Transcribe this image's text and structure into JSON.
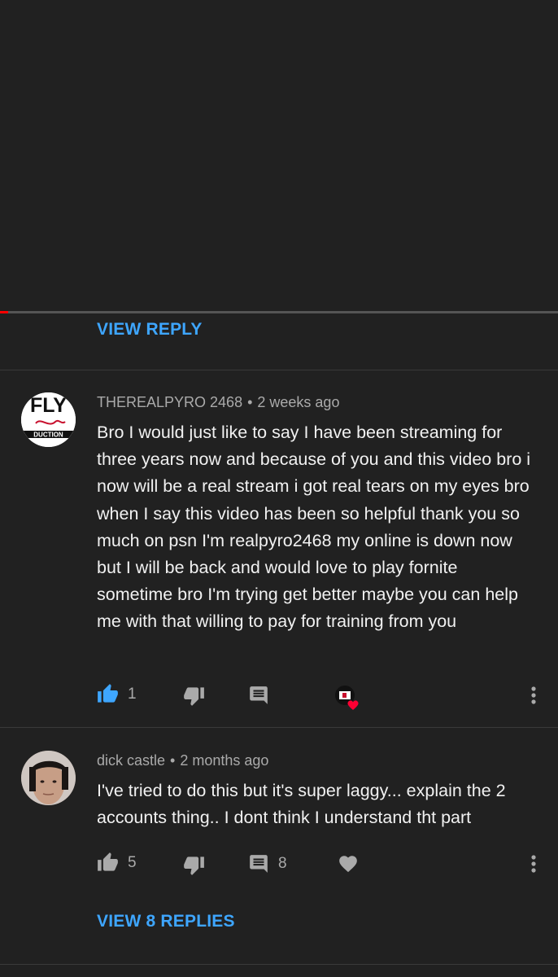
{
  "player": {
    "progress_percent": 1.5
  },
  "view_reply_top": {
    "label": "VIEW REPLY"
  },
  "comments": [
    {
      "author": "THEREALPYRO 2468",
      "separator": "•",
      "time": "2 weeks ago",
      "avatar_text": "FLY",
      "avatar_subtext": "DUCTION",
      "text": "Bro I would just like to say I have been streaming for three years now and because of you and this video bro i now will be a real stream i got real tears on my eyes bro when I say this video has been so helpful thank you so much on psn I'm realpyro2468 my online is down now but I will be back and would love to play fornite sometime bro I'm trying get better maybe you can help me with that willing to pay for training from you",
      "likes": "1",
      "liked": true,
      "creator_hearted": true,
      "like_icon": "thumbs-up-icon",
      "dislike_icon": "thumbs-down-icon",
      "reply_icon": "reply-icon",
      "more_icon": "more-vert-icon"
    },
    {
      "author": "dick castle",
      "separator": "•",
      "time": "2 months ago",
      "text": "I've tried to do this but it's super laggy... explain the 2 accounts thing.. I dont think I understand tht part",
      "likes": "5",
      "replies": "8",
      "liked": false,
      "like_icon": "thumbs-up-icon",
      "dislike_icon": "thumbs-down-icon",
      "reply_icon": "reply-icon",
      "heart_icon": "heart-icon",
      "more_icon": "more-vert-icon",
      "view_replies_label": "VIEW 8 REPLIES"
    }
  ],
  "colors": {
    "background": "#212121",
    "link_blue": "#3ea6ff",
    "liked_blue": "#3ea6ff",
    "icon_gray": "#aaaaaa",
    "heart_red": "#ff0033",
    "progress_red": "#ff0000"
  }
}
